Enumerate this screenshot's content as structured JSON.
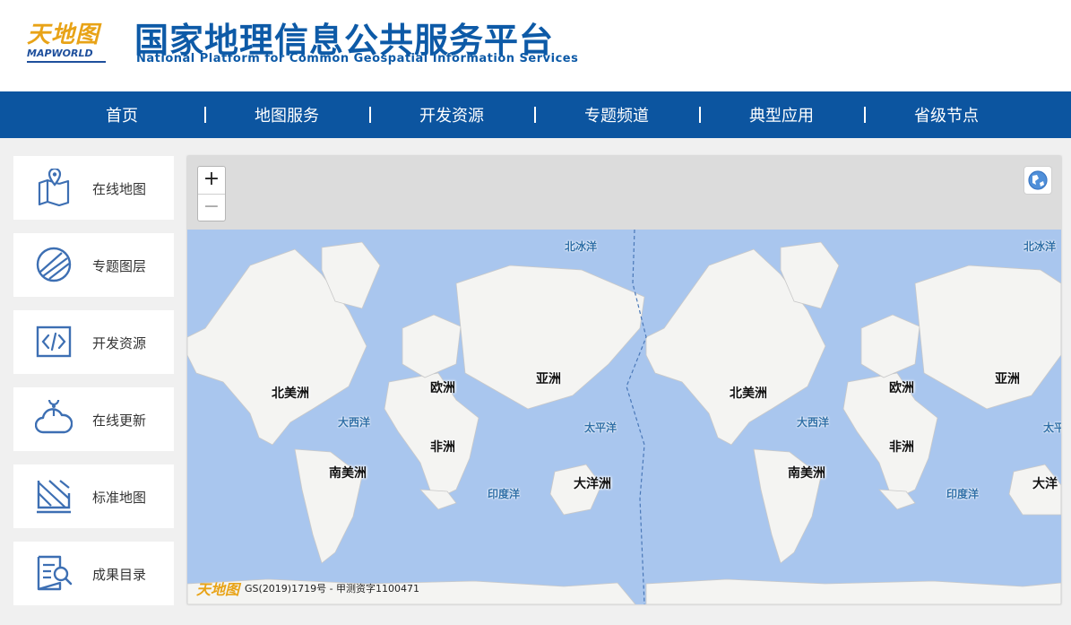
{
  "header": {
    "logo_cn": "天地图",
    "logo_en": "MAPWORLD",
    "title": "国家地理信息公共服务平台",
    "subtitle": "National Platform for Common Geospatial Information Services"
  },
  "nav": {
    "items": [
      "首页",
      "地图服务",
      "开发资源",
      "专题频道",
      "典型应用",
      "省级节点"
    ]
  },
  "sidebar": {
    "items": [
      {
        "label": "在线地图",
        "icon": "map-pin-icon"
      },
      {
        "label": "专题图层",
        "icon": "layer-icon"
      },
      {
        "label": "开发资源",
        "icon": "code-icon"
      },
      {
        "label": "在线更新",
        "icon": "cloud-update-icon"
      },
      {
        "label": "标准地图",
        "icon": "standard-map-icon"
      },
      {
        "label": "成果目录",
        "icon": "catalog-search-icon"
      }
    ]
  },
  "map": {
    "zoom_in": "+",
    "zoom_out": "−",
    "labels": {
      "arctic_1": "北冰洋",
      "arctic_2": "北冰洋",
      "north_america_1": "北美洲",
      "north_america_2": "北美洲",
      "europe_1": "欧洲",
      "europe_2": "欧洲",
      "asia_1": "亚洲",
      "asia_2": "亚洲",
      "atlantic_1": "大西洋",
      "atlantic_2": "大西洋",
      "pacific_1": "太平洋",
      "pacific_2": "太平",
      "africa_1": "非洲",
      "africa_2": "非洲",
      "south_america_1": "南美洲",
      "south_america_2": "南美洲",
      "indian_1": "印度洋",
      "indian_2": "印度洋",
      "oceania_1": "大洋洲",
      "oceania_2": "大洋"
    },
    "attribution_logo": "天地图",
    "attribution": "GS(2019)1719号 - 甲测资字1100471"
  },
  "colors": {
    "brand_blue": "#0c55a0",
    "title_blue": "#0d5aa7",
    "ocean": "#a9c6ee",
    "land": "#f4f4f2",
    "logo_gold": "#e8a317"
  }
}
